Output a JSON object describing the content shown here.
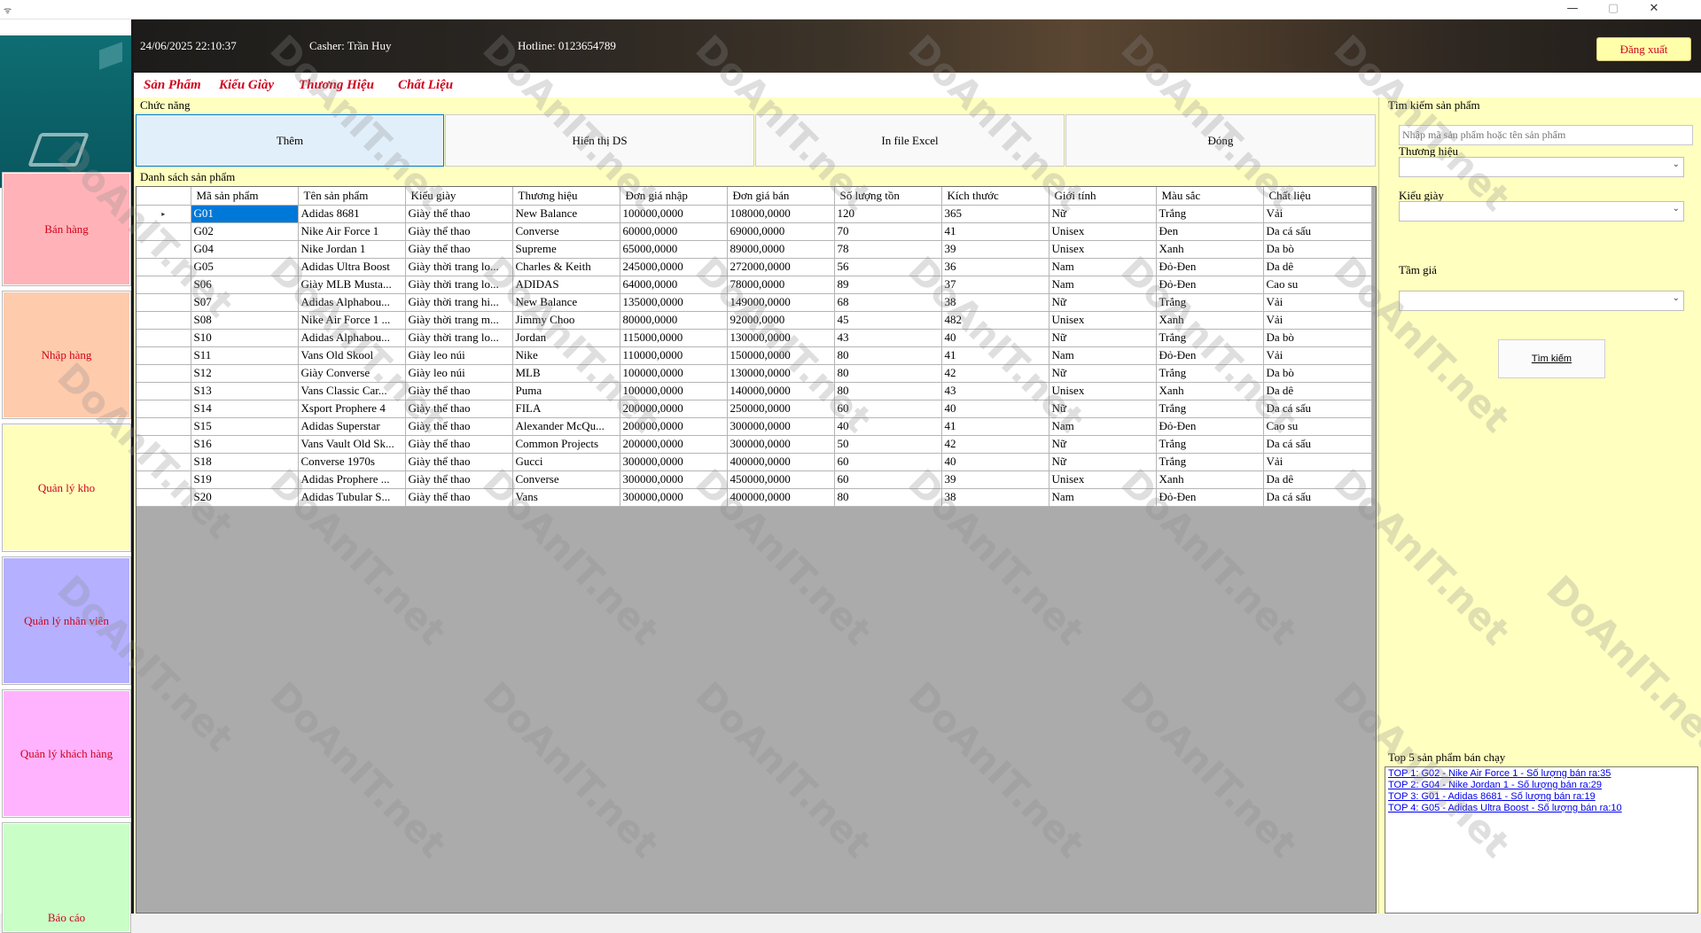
{
  "window": {
    "app_icon": "ᯤ",
    "min": "—",
    "max": "▢",
    "close": "✕"
  },
  "sidebar": {
    "items": [
      {
        "label": "Bán hàng",
        "color": "#ffb3b8"
      },
      {
        "label": "Nhập hàng",
        "color": "#ffcbad"
      },
      {
        "label": "Quản lý kho",
        "color": "#ffffbb"
      },
      {
        "label": "Quản lý nhân viên",
        "color": "#b5b0ff"
      },
      {
        "label": "Quản lý khách hàng",
        "color": "#ffb3ff"
      },
      {
        "label": "Báo cáo",
        "color": "#c9ffc7"
      }
    ]
  },
  "header": {
    "datetime": "24/06/2025 22:10:37",
    "cashier": "Casher: Trần Huy",
    "hotline": "Hotline: 0123654789",
    "logout": "Đăng xuất"
  },
  "menu": {
    "items": [
      "Sản Phẩm",
      "Kiểu Giày",
      "Thương Hiệu",
      "Chất Liệu"
    ]
  },
  "functions": {
    "label": "Chức năng",
    "buttons": [
      "Thêm",
      "Hiển thị DS",
      "In file Excel",
      "Đóng"
    ]
  },
  "product_list": {
    "label": "Danh sách sản phẩm",
    "columns": [
      "Mã sản phẩm",
      "Tên sản phẩm",
      "Kiểu giày",
      "Thương hiệu",
      "Đơn giá nhập",
      "Đơn giá bán",
      "Số lượng tồn",
      "Kích thước",
      "Giới tính",
      "Màu sắc",
      "Chất liệu"
    ],
    "rows": [
      [
        "G01",
        "Adidas 8681",
        "Giày thể thao",
        "New Balance",
        "100000,0000",
        "108000,0000",
        "120",
        "365",
        "Nữ",
        "Trắng",
        "Vải"
      ],
      [
        "G02",
        "Nike Air Force 1",
        "Giày thể thao",
        "Converse",
        "60000,0000",
        "69000,0000",
        "70",
        "41",
        "Unisex",
        "Đen",
        "Da cá sấu"
      ],
      [
        "G04",
        "Nike Jordan 1",
        "Giày thể thao",
        " Supreme",
        "65000,0000",
        "89000,0000",
        "78",
        "39",
        "Unisex",
        "Xanh",
        "Da bò"
      ],
      [
        "G05",
        "Adidas Ultra Boost",
        "Giày thời trang lo...",
        "Charles & Keith",
        "245000,0000",
        "272000,0000",
        "56",
        "36",
        "Nam",
        "Đỏ-Đen",
        "Da dê"
      ],
      [
        "S06",
        "Giày MLB Musta...",
        "Giày thời trang lo...",
        "ADIDAS",
        "64000,0000",
        "78000,0000",
        "89",
        "37",
        "Nam",
        "Đỏ-Đen",
        "Cao su"
      ],
      [
        "S07",
        "Adidas Alphabou...",
        "Giày thời trang hi...",
        "New Balance",
        "135000,0000",
        "149000,0000",
        "68",
        "38",
        "Nữ",
        "Trắng",
        "Vải"
      ],
      [
        "S08",
        "Nike Air Force 1 ...",
        "Giày thời trang m...",
        "Jimmy Choo",
        "80000,0000",
        "92000,0000",
        "45",
        "482",
        "Unisex",
        "Xanh",
        "Vải"
      ],
      [
        "S10",
        "Adidas Alphabou...",
        "Giày thời trang lo...",
        "Jordan",
        "115000,0000",
        "130000,0000",
        "43",
        "40",
        "Nữ",
        "Trắng",
        "Da bò"
      ],
      [
        "S11",
        "Vans Old Skool",
        "Giày leo núi",
        "Nike",
        "110000,0000",
        "150000,0000",
        "80",
        "41",
        "Nam",
        "Đỏ-Đen",
        "Vải"
      ],
      [
        "S12",
        "Giày Converse",
        "Giày leo núi",
        "MLB",
        "100000,0000",
        "130000,0000",
        "80",
        "42",
        "Nữ",
        "Trắng",
        "Da bò"
      ],
      [
        "S13",
        "Vans Classic Car...",
        "Giày thể thao",
        "Puma",
        "100000,0000",
        "140000,0000",
        "80",
        "43",
        "Unisex",
        "Xanh",
        "Da dê"
      ],
      [
        "S14",
        "Xsport Prophere 4",
        "Giày thể thao",
        "FILA",
        "200000,0000",
        "250000,0000",
        "60",
        "40",
        "Nữ",
        "Trắng",
        "Da cá sấu"
      ],
      [
        "S15",
        "Adidas Superstar",
        "Giày thể thao",
        "Alexander McQu...",
        "200000,0000",
        "300000,0000",
        "40",
        "41",
        "Nam",
        "Đỏ-Đen",
        "Cao su"
      ],
      [
        "S16",
        "Vans Vault Old Sk...",
        "Giày thể thao",
        "Common Projects",
        "200000,0000",
        "300000,0000",
        "50",
        "42",
        "Nữ",
        "Trắng",
        "Da cá sấu"
      ],
      [
        "S18",
        "Converse 1970s",
        "Giày thể thao",
        "Gucci",
        "300000,0000",
        "400000,0000",
        "60",
        "40",
        "Nữ",
        "Trắng",
        "Vải"
      ],
      [
        "S19",
        "Adidas Prophere ...",
        "Giày thể thao",
        "Converse",
        "300000,0000",
        "450000,0000",
        "60",
        "39",
        "Unisex",
        "Xanh",
        "Da dê"
      ],
      [
        "S20",
        "Adidas Tubular S...",
        "Giày thể thao",
        "Vans",
        "300000,0000",
        "400000,0000",
        "80",
        "38",
        "Nam",
        "Đỏ-Đen",
        "Da cá sấu"
      ]
    ]
  },
  "search": {
    "label": "Tìm kiếm sản phẩm",
    "placeholder": "Nhập mã sản phẩm hoặc tên sản phẩm",
    "brand_label": "Thương hiệu",
    "type_label": "Kiểu giày",
    "price_label": "Tầm giá",
    "button": "Tìm kiếm"
  },
  "top5": {
    "label": "Top 5 sản phẩm bán chạy",
    "items": [
      "TOP 1: G02 - Nike Air Force 1  - Số lượng bán ra:35",
      "TOP 2: G04 - Nike Jordan 1 - Số lượng bán ra:29",
      "TOP 3: G01 - Adidas 8681  - Số lượng bán ra:19",
      "TOP 4: G05 - Adidas Ultra Boost - Số lượng bán ra:10"
    ]
  },
  "watermark": "DoAnIT.net"
}
